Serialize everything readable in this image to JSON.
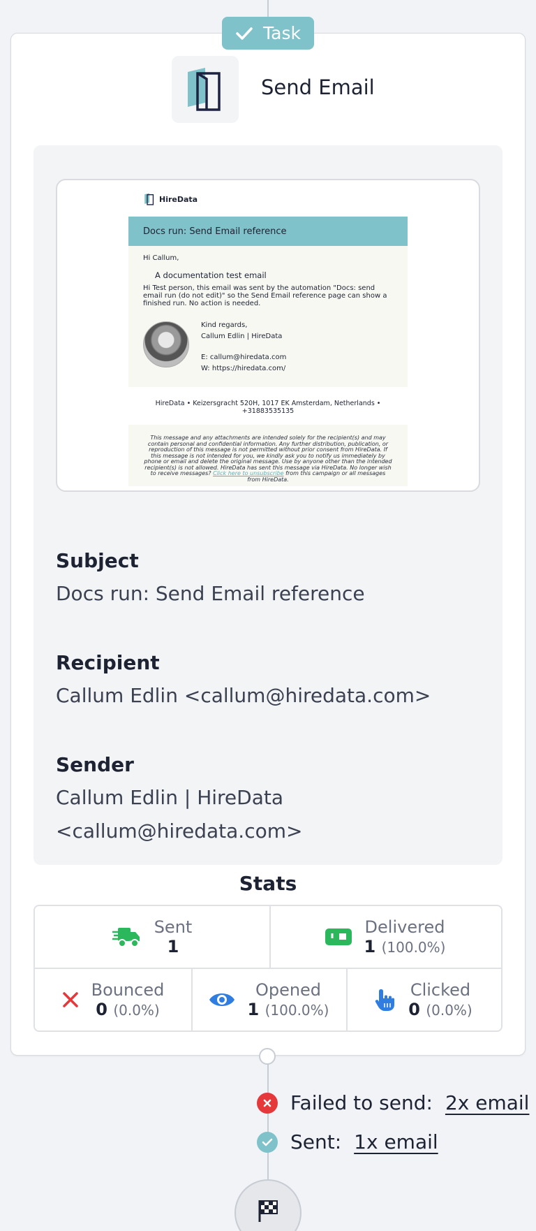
{
  "task": {
    "badge_label": "Task",
    "title": "Send Email"
  },
  "preview": {
    "brand": "HireData",
    "header": "Docs run: Send Email reference",
    "greeting": "Hi Callum,",
    "headline": "A documentation test email",
    "message": "Hi Test person, this email was sent by the automation \"Docs: send email run (do not edit)\" so the Send Email reference page can show a finished run. No action is needed.",
    "sig_regards": "Kind regards,",
    "sig_name": "Callum Edlin | HireData",
    "sig_email": "E: callum@hiredata.com",
    "sig_web": "W: https://hiredata.com/",
    "address": "HireData • Keizersgracht 520H, 1017 EK Amsterdam, Netherlands • +31883535135",
    "disclaimer": "This message and any attachments are intended solely for the recipient(s) and may contain personal and confidential information. Any further distribution, publication, or reproduction of this message is not permitted without prior consent from HireData. If this message is not intended for you, we kindly ask you to notify us immediately by phone or email and delete the original message. Use by anyone other than the intended recipient(s) is not allowed. HireData has sent this message via HireData. No longer wish to receive messages?",
    "unsubscribe_link": "Click here to unsubscribe",
    "disclaimer_end": "from this campaign or all messages from HireData."
  },
  "fields": {
    "subject_label": "Subject",
    "subject_value": "Docs run: Send Email reference",
    "recipient_label": "Recipient",
    "recipient_value": "Callum Edlin <callum@hiredata.com>",
    "sender_label": "Sender",
    "sender_value": "Callum Edlin | HireData <callum@hiredata.com>"
  },
  "stats": {
    "title": "Stats",
    "sent": {
      "label": "Sent",
      "value": "1"
    },
    "delivered": {
      "label": "Delivered",
      "value": "1",
      "pct": "(100.0%)"
    },
    "bounced": {
      "label": "Bounced",
      "value": "0",
      "pct": "(0.0%)"
    },
    "opened": {
      "label": "Opened",
      "value": "1",
      "pct": "(100.0%)"
    },
    "clicked": {
      "label": "Clicked",
      "value": "0",
      "pct": "(0.0%)"
    }
  },
  "outcomes": {
    "failed_label": "Failed to send:",
    "failed_link": "2x email",
    "sent_label": "Sent:",
    "sent_link": "1x email"
  },
  "colors": {
    "accent": "#7fc2c9",
    "success": "#2bb85c",
    "danger": "#e5383b",
    "info": "#2f7de1"
  }
}
